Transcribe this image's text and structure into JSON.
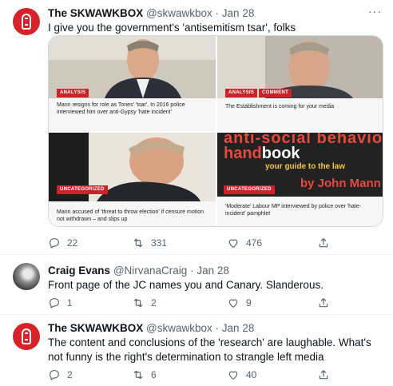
{
  "tweets": [
    {
      "name": "The SKWAWKBOX",
      "handle": "@skwawkbox",
      "date": "Jan 28",
      "text": "I give you the government's 'antisemitism tsar', folks",
      "media": [
        {
          "tag": "ANALYSIS",
          "caption": "Mann resigns for role as Tories' 'tsar'. In 2016 police interviewed him over anti-Gypsy 'hate incident'"
        },
        {
          "tags": [
            "ANALYSIS",
            "COMMENT"
          ],
          "caption": "The Establishment is coming for your media"
        },
        {
          "tag": "UNCATEGORIZED",
          "caption": "Mann accused of 'threat to throw election' if censure motion not withdrawn – and slips up"
        },
        {
          "tag": "UNCATEGORIZED",
          "caption": "'Moderate' Labour MP interviewed by police over 'hate-incident' pamphlet",
          "image_text": {
            "line1": "anti-social behaviour",
            "line2a": "hand",
            "line2b": "book",
            "line3": "your guide to the law",
            "line4": "by John Mann MP"
          }
        }
      ],
      "replies": "22",
      "retweets": "331",
      "likes": "476"
    },
    {
      "name": "Craig Evans",
      "handle": "@NirvanaCraig",
      "date": "Jan 28",
      "text": "Front page of the JC names you and Canary. Slanderous.",
      "replies": "1",
      "retweets": "2",
      "likes": "9"
    },
    {
      "name": "The SKWAWKBOX",
      "handle": "@skwawkbox",
      "date": "Jan 28",
      "text": "The content and conclusions of the 'research' are laughable. What's not funny is the right's determination to strangle left media",
      "replies": "2",
      "retweets": "6",
      "likes": "40"
    }
  ],
  "separator": "·",
  "more_icon": "···",
  "icons": [
    "reply-icon",
    "retweet-icon",
    "like-icon",
    "share-icon",
    "more-icon"
  ],
  "colors": {
    "text": "#0f1419",
    "secondary": "#536471",
    "divider": "#eff3f4",
    "brand_red": "#d8222a"
  }
}
